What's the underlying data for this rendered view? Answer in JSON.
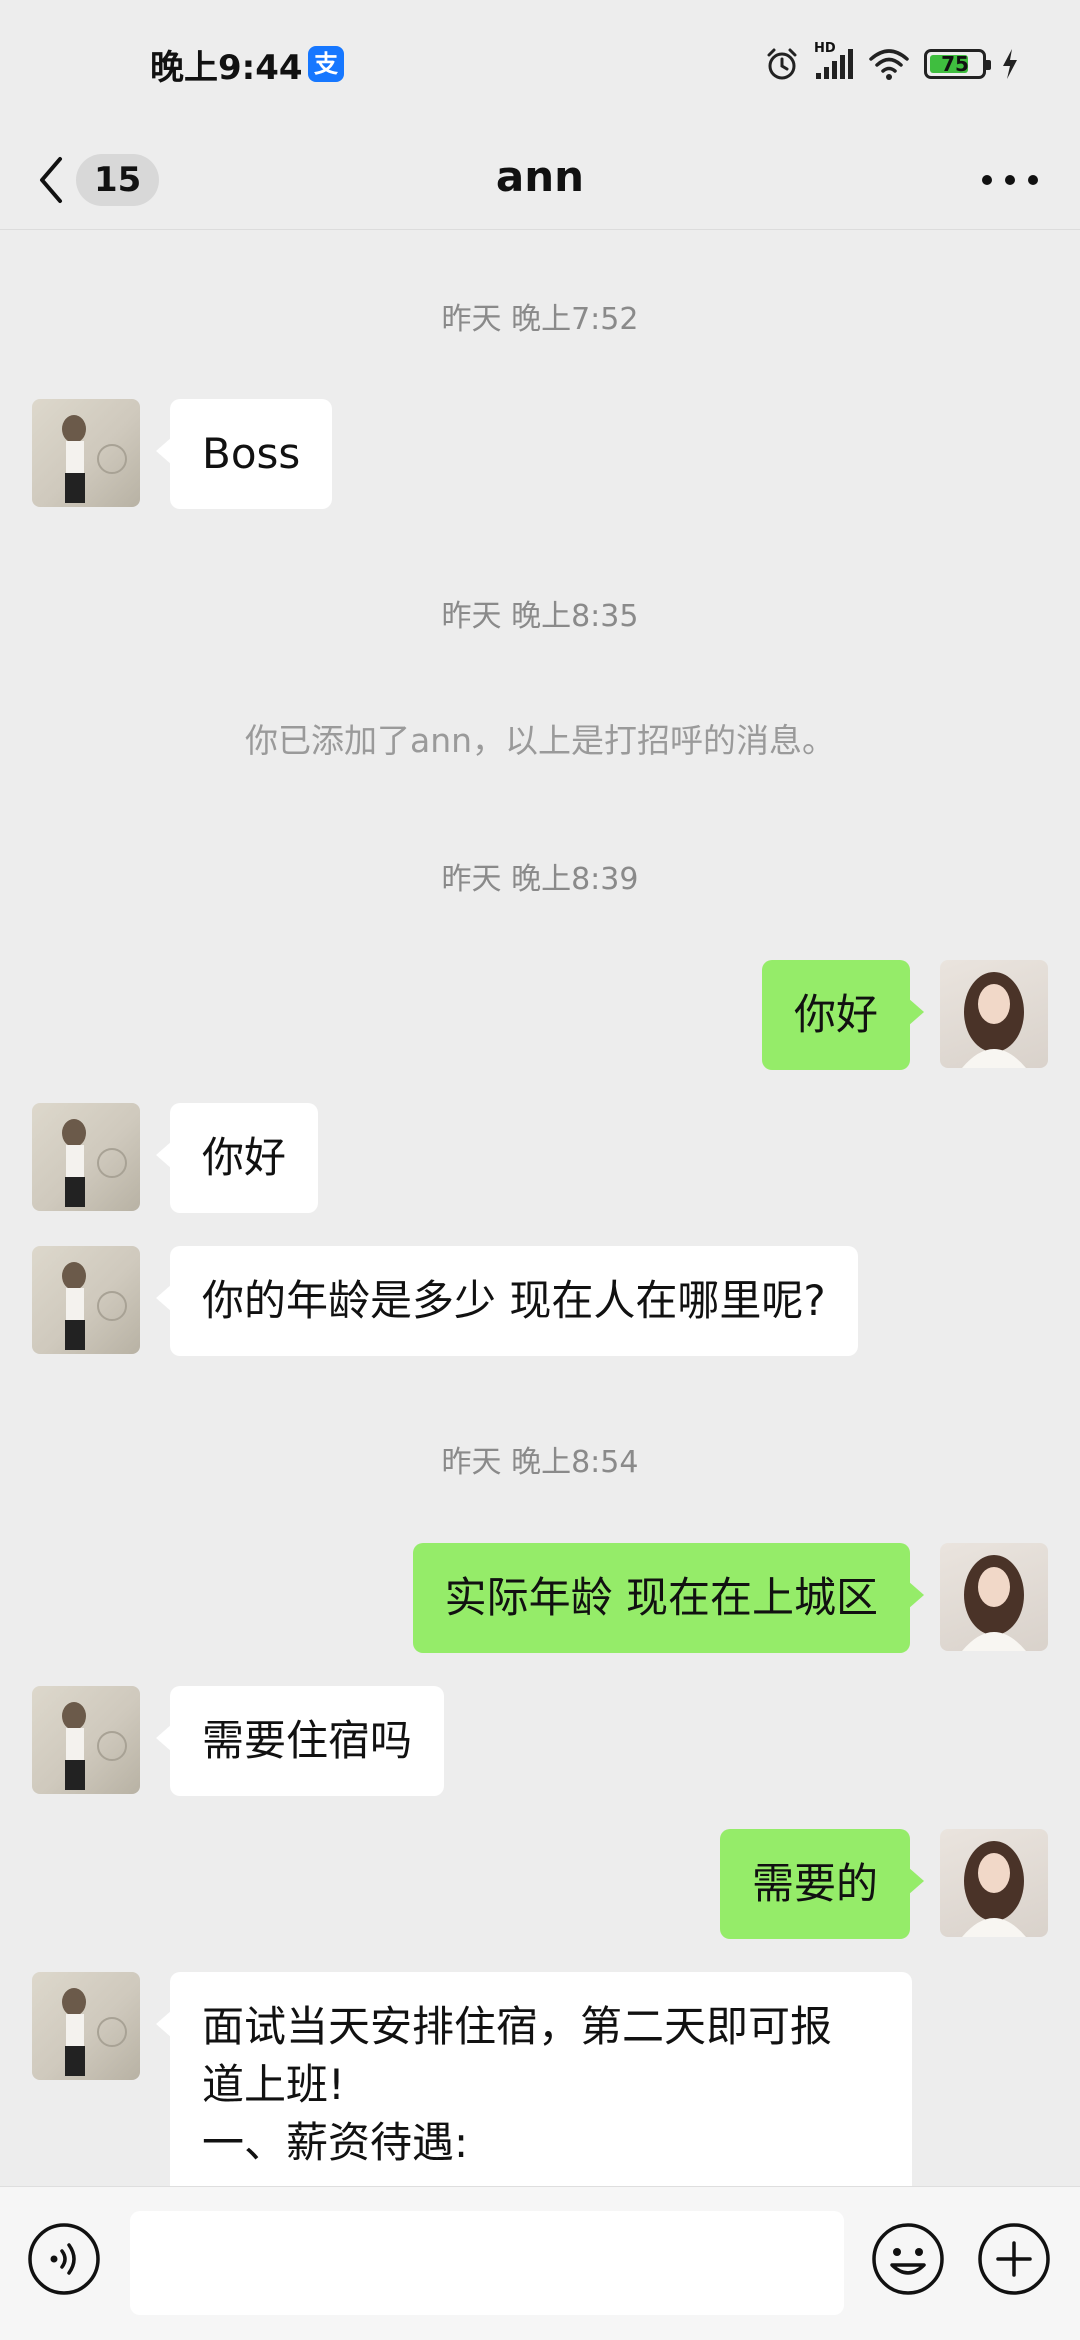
{
  "status_bar": {
    "time": "晚上9:44",
    "alipay_glyph": "支",
    "network_label": "HD",
    "battery_level": "75",
    "battery_fraction": 0.75
  },
  "nav": {
    "back_icon": "chevron-left-icon",
    "unread_count": "15",
    "title": "ann",
    "more_icon": "more-dots-icon"
  },
  "chat": {
    "timestamps": [
      "昨天 晚上7:52",
      "昨天 晚上8:35",
      "昨天 晚上8:39",
      "昨天 晚上8:54"
    ],
    "system_message": "你已添加了ann，以上是打招呼的消息。",
    "messages": [
      {
        "side": "left",
        "text": "Boss"
      },
      {
        "side": "right",
        "text": "你好"
      },
      {
        "side": "left",
        "text": "你好"
      },
      {
        "side": "left",
        "text": "你的年龄是多少 现在人在哪里呢?"
      },
      {
        "side": "right",
        "text": "实际年龄 现在在上城区"
      },
      {
        "side": "left",
        "text": "需要住宿吗"
      },
      {
        "side": "right",
        "text": "需要的"
      },
      {
        "side": "left",
        "text": "面试当天安排住宿，第二天即可报\n道上班!\n一、薪资待遇:"
      }
    ]
  },
  "input_bar": {
    "voice_icon": "voice-icon",
    "emoji_icon": "emoji-icon",
    "plus_icon": "plus-icon",
    "input_value": ""
  },
  "colors": {
    "background": "#ededed",
    "bubble_self": "#95ec69",
    "bubble_other": "#ffffff",
    "timestamp": "#8a8a8a"
  }
}
